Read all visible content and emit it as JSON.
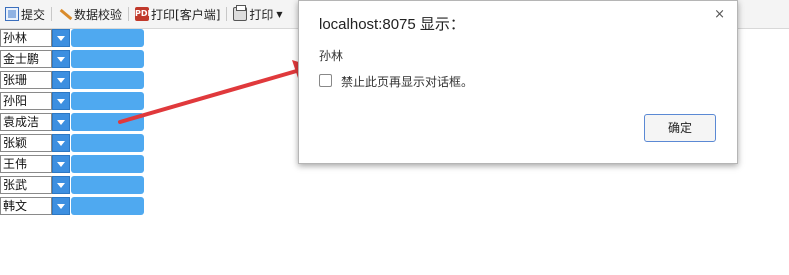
{
  "toolbar": {
    "submit_label": "提交",
    "verify_label": "数据校验",
    "print_client_label": "打印[客户端]",
    "print_label": "打印"
  },
  "rows": [
    {
      "name": "孙林"
    },
    {
      "name": "金士鹏"
    },
    {
      "name": "张珊"
    },
    {
      "name": "孙阳"
    },
    {
      "name": "袁成洁"
    },
    {
      "name": "张颖"
    },
    {
      "name": "王伟"
    },
    {
      "name": "张武"
    },
    {
      "name": "韩文"
    }
  ],
  "dialog": {
    "title": "localhost:8075 显示：",
    "message": "孙林",
    "checkbox_label": "禁止此页再显示对话框。",
    "ok_label": "确定",
    "close_symbol": "×"
  },
  "colors": {
    "arrow": "#e0393c",
    "bar": "#4fa9f0",
    "dropdown": "#3d8fe0"
  }
}
